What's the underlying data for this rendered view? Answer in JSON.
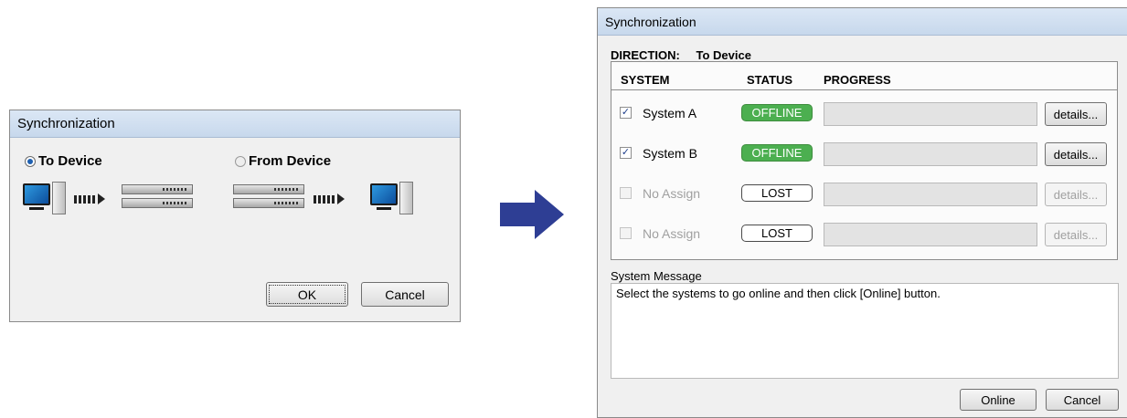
{
  "left_dialog": {
    "title": "Synchronization",
    "options": [
      {
        "label": "To Device",
        "selected": true
      },
      {
        "label": "From Device",
        "selected": false
      }
    ],
    "buttons": {
      "ok": "OK",
      "cancel": "Cancel"
    }
  },
  "arrow_icon": "right-arrow-icon",
  "right_dialog": {
    "title": "Synchronization",
    "direction_label": "DIRECTION:",
    "direction_value": "To Device",
    "columns": {
      "system": "SYSTEM",
      "status": "STATUS",
      "progress": "PROGRESS"
    },
    "rows": [
      {
        "name": "System A",
        "checked": true,
        "enabled": true,
        "status": "OFFLINE",
        "details": "details..."
      },
      {
        "name": "System B",
        "checked": true,
        "enabled": true,
        "status": "OFFLINE",
        "details": "details..."
      },
      {
        "name": "No Assign",
        "checked": false,
        "enabled": false,
        "status": "LOST",
        "details": "details..."
      },
      {
        "name": "No Assign",
        "checked": false,
        "enabled": false,
        "status": "LOST",
        "details": "details..."
      }
    ],
    "system_message_label": "System Message",
    "system_message": "Select the systems to go online and then click [Online] button.",
    "buttons": {
      "online": "Online",
      "cancel": "Cancel"
    }
  },
  "colors": {
    "offline": "#4caf50",
    "arrow": "#2e3e94",
    "title_bar": "#c7d8ec"
  }
}
